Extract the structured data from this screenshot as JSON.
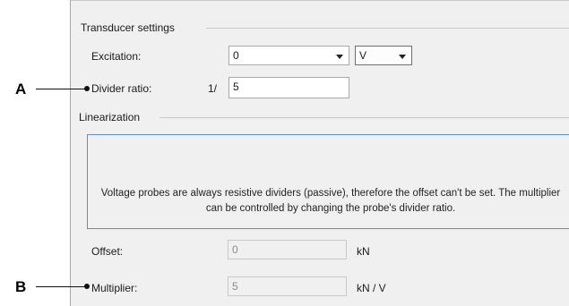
{
  "transducer": {
    "group_title": "Transducer settings",
    "excitation_label": "Excitation:",
    "excitation_value": "0",
    "excitation_unit": "V",
    "divider_label": "Divider ratio:",
    "divider_prefix": "1/",
    "divider_value": "5"
  },
  "linearization": {
    "group_title": "Linearization",
    "info_text": "Voltage probes are always resistive dividers (passive), therefore the offset can't be set. The multiplier can be controlled by changing the probe's divider ratio.",
    "offset_label": "Offset:",
    "offset_value": "0",
    "offset_unit": "kN",
    "multiplier_label": "Multiplier:",
    "multiplier_value": "5",
    "multiplier_unit": "kN / V"
  },
  "callouts": {
    "a": "A",
    "b": "B"
  }
}
